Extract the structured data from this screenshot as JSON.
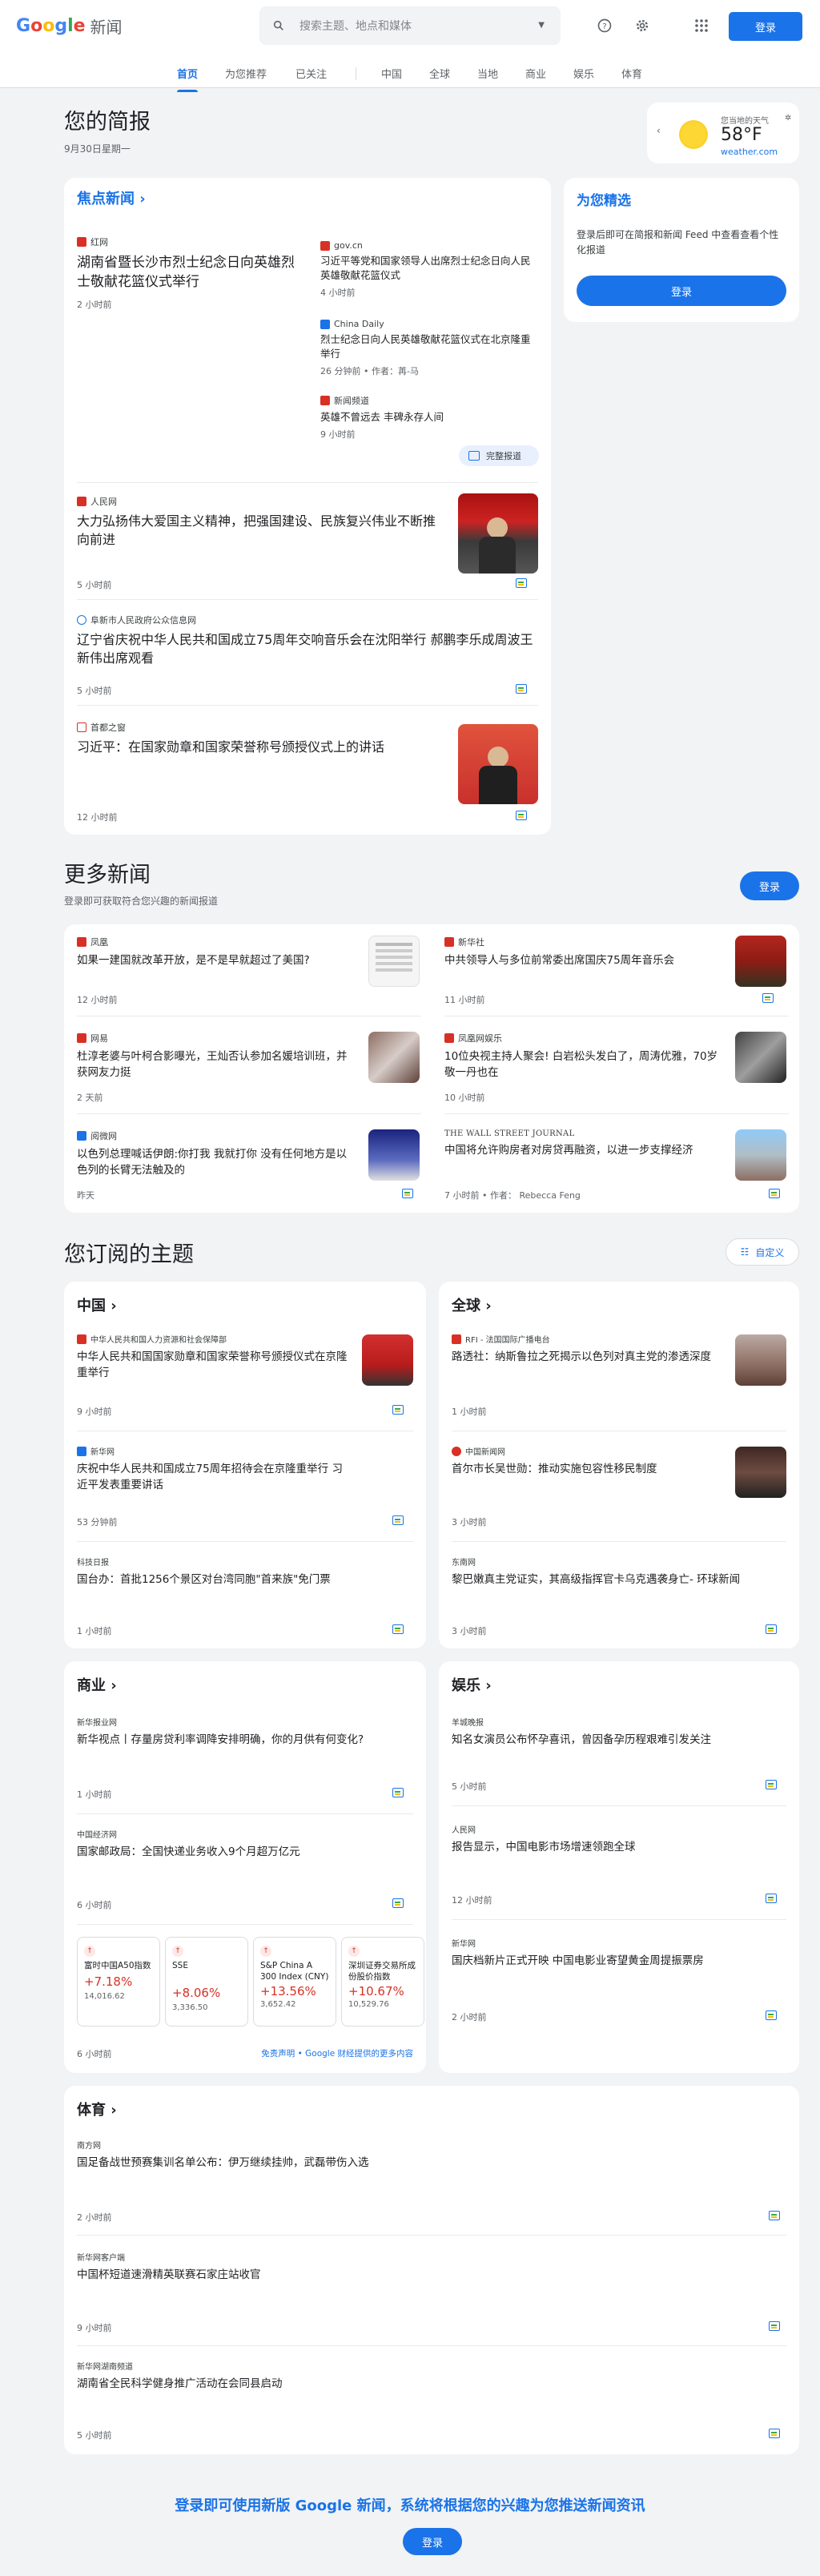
{
  "header": {
    "logo_google": "Google",
    "logo_news": "新闻",
    "search_placeholder": "搜索主题、地点和媒体",
    "login": "登录"
  },
  "tabs": [
    "首页",
    "为您推荐",
    "已关注",
    "中国",
    "全球",
    "当地",
    "商业",
    "娱乐",
    "体育"
  ],
  "briefing": {
    "title": "您的简报",
    "date": "9月30日星期一"
  },
  "weather": {
    "label": "您当地的天气",
    "temp": "58°F",
    "source": "weather.com"
  },
  "top": {
    "title": "焦点新闻",
    "main": {
      "source": "红网",
      "headline": "湖南省暨长沙市烈士纪念日向英雄烈士敬献花篮仪式举行",
      "time": "2 小时前"
    },
    "side": [
      {
        "source": "gov.cn",
        "headline": "习近平等党和国家领导人出席烈士纪念日向人民英雄敬献花篮仪式",
        "time": "4 小时前"
      },
      {
        "source": "China Daily",
        "headline": "烈士纪念日向人民英雄敬献花篮仪式在北京隆重举行",
        "time": "26 分钟前 • 作者：苒-马"
      },
      {
        "source": "新闻频道",
        "headline": "英雄不曾远去 丰碑永存人间",
        "time": "9 小时前"
      }
    ],
    "full": "完整报道",
    "stories": [
      {
        "source": "人民网",
        "headline": "大力弘扬伟大爱国主义精神，把强国建设、民族复兴伟业不断推向前进",
        "time": "5 小时前"
      },
      {
        "source": "阜新市人民政府公众信息网",
        "headline": "辽宁省庆祝中华人民共和国成立75周年交响音乐会在沈阳举行 郝鹏李乐成周波王新伟出席观看",
        "time": "5 小时前"
      },
      {
        "source": "首都之窗",
        "headline": "习近平：在国家勋章和国家荣誉称号颁授仪式上的讲话",
        "time": "12 小时前"
      }
    ]
  },
  "picks": {
    "title": "为您精选",
    "desc": "登录后即可在简报和新闻 Feed 中查看查看个性化报道",
    "login": "登录"
  },
  "more": {
    "title": "更多新闻",
    "desc": "登录即可获取符合您兴趣的新闻报道",
    "login": "登录",
    "items": [
      {
        "source": "凤凰",
        "headline": "如果一建国就改革开放，是不是早就超过了美国?",
        "time": "12 小时前"
      },
      {
        "source": "新华社",
        "headline": "中共领导人与多位前常委出席国庆75周年音乐会",
        "time": "11 小时前"
      },
      {
        "source": "网易",
        "headline": "杜淳老婆与叶柯合影曝光，王灿否认参加名媛培训班，并获网友力挺",
        "time": "2 天前"
      },
      {
        "source": "凤凰网娱乐",
        "headline": "10位央视主持人聚会! 白岩松头发白了，周涛优雅，70岁敬一丹也在",
        "time": "10 小时前"
      },
      {
        "source": "阅微网",
        "headline": "以色列总理喊话伊朗:你打我 我就打你 没有任何地方是以色列的长臂无法触及的",
        "time": "昨天"
      },
      {
        "source": "THE WALL STREET JOURNAL",
        "headline": "中国将允许购房者对房贷再融资，以进一步支撑经济",
        "time": "7 小时前 • 作者： Rebecca Feng"
      }
    ]
  },
  "topics": {
    "title": "您订阅的主题",
    "custom": "自定义",
    "china": {
      "title": "中国",
      "items": [
        {
          "source": "中华人民共和国人力资源和社会保障部",
          "headline": "中华人民共和国国家勋章和国家荣誉称号颁授仪式在京隆重举行",
          "time": "9 小时前"
        },
        {
          "source": "新华网",
          "headline": "庆祝中华人民共和国成立75周年招待会在京隆重举行 习近平发表重要讲话",
          "time": "53 分钟前"
        },
        {
          "source": "科技日报",
          "headline": "国台办：首批1256个景区对台湾同胞\"首来族\"免门票",
          "time": "1 小时前"
        }
      ]
    },
    "world": {
      "title": "全球",
      "items": [
        {
          "source": "RFI - 法国国际广播电台",
          "headline": "路透社：纳斯鲁拉之死揭示以色列对真主党的渗透深度",
          "time": "1 小时前"
        },
        {
          "source": "中国新闻网",
          "headline": "首尔市长吴世勋：推动实施包容性移民制度",
          "time": "3 小时前"
        },
        {
          "source": "东南网",
          "headline": "黎巴嫩真主党证实，其高级指挥官卡乌克遇袭身亡- 环球新闻",
          "time": "3 小时前"
        }
      ]
    },
    "biz": {
      "title": "商业",
      "items": [
        {
          "source": "新华报业网",
          "headline": "新华视点丨存量房贷利率调降安排明确，你的月供有何变化?",
          "time": "1 小时前"
        },
        {
          "source": "中国经济网",
          "headline": "国家邮政局：全国快递业务收入9个月超万亿元",
          "time": "6 小时前"
        }
      ],
      "stocks": [
        {
          "name": "富时中国A50指数",
          "chg": "+7.18%",
          "val": "14,016.62"
        },
        {
          "name": "SSE",
          "chg": "+8.06%",
          "val": "3,336.50"
        },
        {
          "name": "S&P China A 300 Index (CNY)",
          "chg": "+13.56%",
          "val": "3,652.42"
        },
        {
          "name": "深圳证券交易所成份股价指数",
          "chg": "+10.67%",
          "val": "10,529.76"
        }
      ],
      "stocks_time": "6 小时前",
      "disclaimer": "免责声明 • Google 财经提供的更多内容"
    },
    "ent": {
      "title": "娱乐",
      "items": [
        {
          "source": "羊城晚报",
          "headline": "知名女演员公布怀孕喜讯，曾因备孕历程艰难引发关注",
          "time": "5 小时前"
        },
        {
          "source": "人民网",
          "headline": "报告显示，中国电影市场增速领跑全球",
          "time": "12 小时前"
        },
        {
          "source": "新华网",
          "headline": "国庆档新片正式开映 中国电影业寄望黄金周提振票房",
          "time": "2 小时前"
        }
      ]
    },
    "sports": {
      "title": "体育",
      "items": [
        {
          "source": "南方网",
          "headline": "国足备战世预赛集训名单公布：伊万继续挂帅，武磊带伤入选",
          "time": "2 小时前"
        },
        {
          "source": "新华网客户端",
          "headline": "中国杯短道速滑精英联赛石家庄站收官",
          "time": "9 小时前"
        },
        {
          "source": "新华网湖南频道",
          "headline": "湖南省全民科学健身推广活动在会同县启动",
          "time": "5 小时前"
        }
      ]
    }
  },
  "footer": {
    "cta": "登录即可使用新版 Google 新闻，系统将根据您的兴趣为您推送新闻资讯",
    "login": "登录"
  },
  "colors": {
    "accent": "#1a73e8",
    "green": "#34a853",
    "red": "#d93025",
    "yellow": "#fbbc04"
  }
}
